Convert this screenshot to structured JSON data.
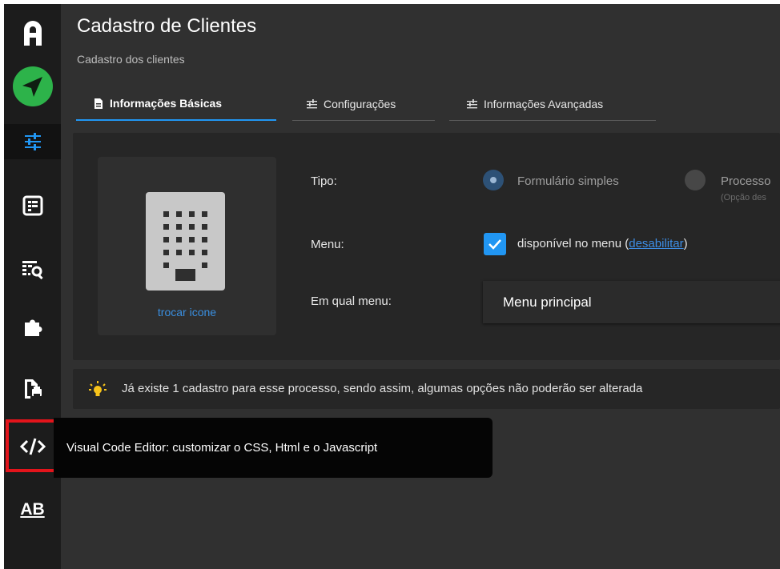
{
  "sidebar": {
    "items": [
      {
        "icon": "logo-a-icon"
      },
      {
        "icon": "send-icon",
        "color": "#2db34a"
      },
      {
        "icon": "tune-icon",
        "active": true
      },
      {
        "icon": "form-icon"
      },
      {
        "icon": "table-search-icon"
      },
      {
        "icon": "puzzle-icon"
      },
      {
        "icon": "file-print-icon"
      },
      {
        "icon": "code-icon",
        "highlighted": true
      },
      {
        "icon": "ab-text-icon",
        "label": "AB"
      }
    ],
    "highlight_color": "#e3141b"
  },
  "header": {
    "title": "Cadastro de Clientes",
    "subtitle": "Cadastro dos clientes"
  },
  "tabs": [
    {
      "label": "Informações Básicas",
      "icon": "document-icon",
      "active": true
    },
    {
      "label": "Configurações",
      "icon": "tune-icon"
    },
    {
      "label": "Informações Avançadas",
      "icon": "tune-icon"
    }
  ],
  "form": {
    "icon_link": "trocar icone",
    "tipo_label": "Tipo:",
    "tipo_options": [
      {
        "label": "Formulário simples",
        "selected": true
      },
      {
        "label": "Processo",
        "hint": "(Opção des"
      }
    ],
    "menu_label": "Menu:",
    "menu_checked": true,
    "menu_text": "disponível no menu (",
    "menu_link": "desabilitar",
    "menu_text_end": ")",
    "qual_menu_label": "Em qual menu:",
    "qual_menu_value": "Menu principal"
  },
  "info_bar": {
    "icon": "lightbulb-icon",
    "text": "Já existe 1 cadastro para esse processo, sendo assim, algumas opções não poderão ser alterada"
  },
  "tooltip": {
    "text": "Visual Code Editor: customizar o CSS, Html e o Javascript"
  },
  "colors": {
    "accent": "#2196f3",
    "background": "#303030",
    "sidebar": "#1c1c1c"
  }
}
